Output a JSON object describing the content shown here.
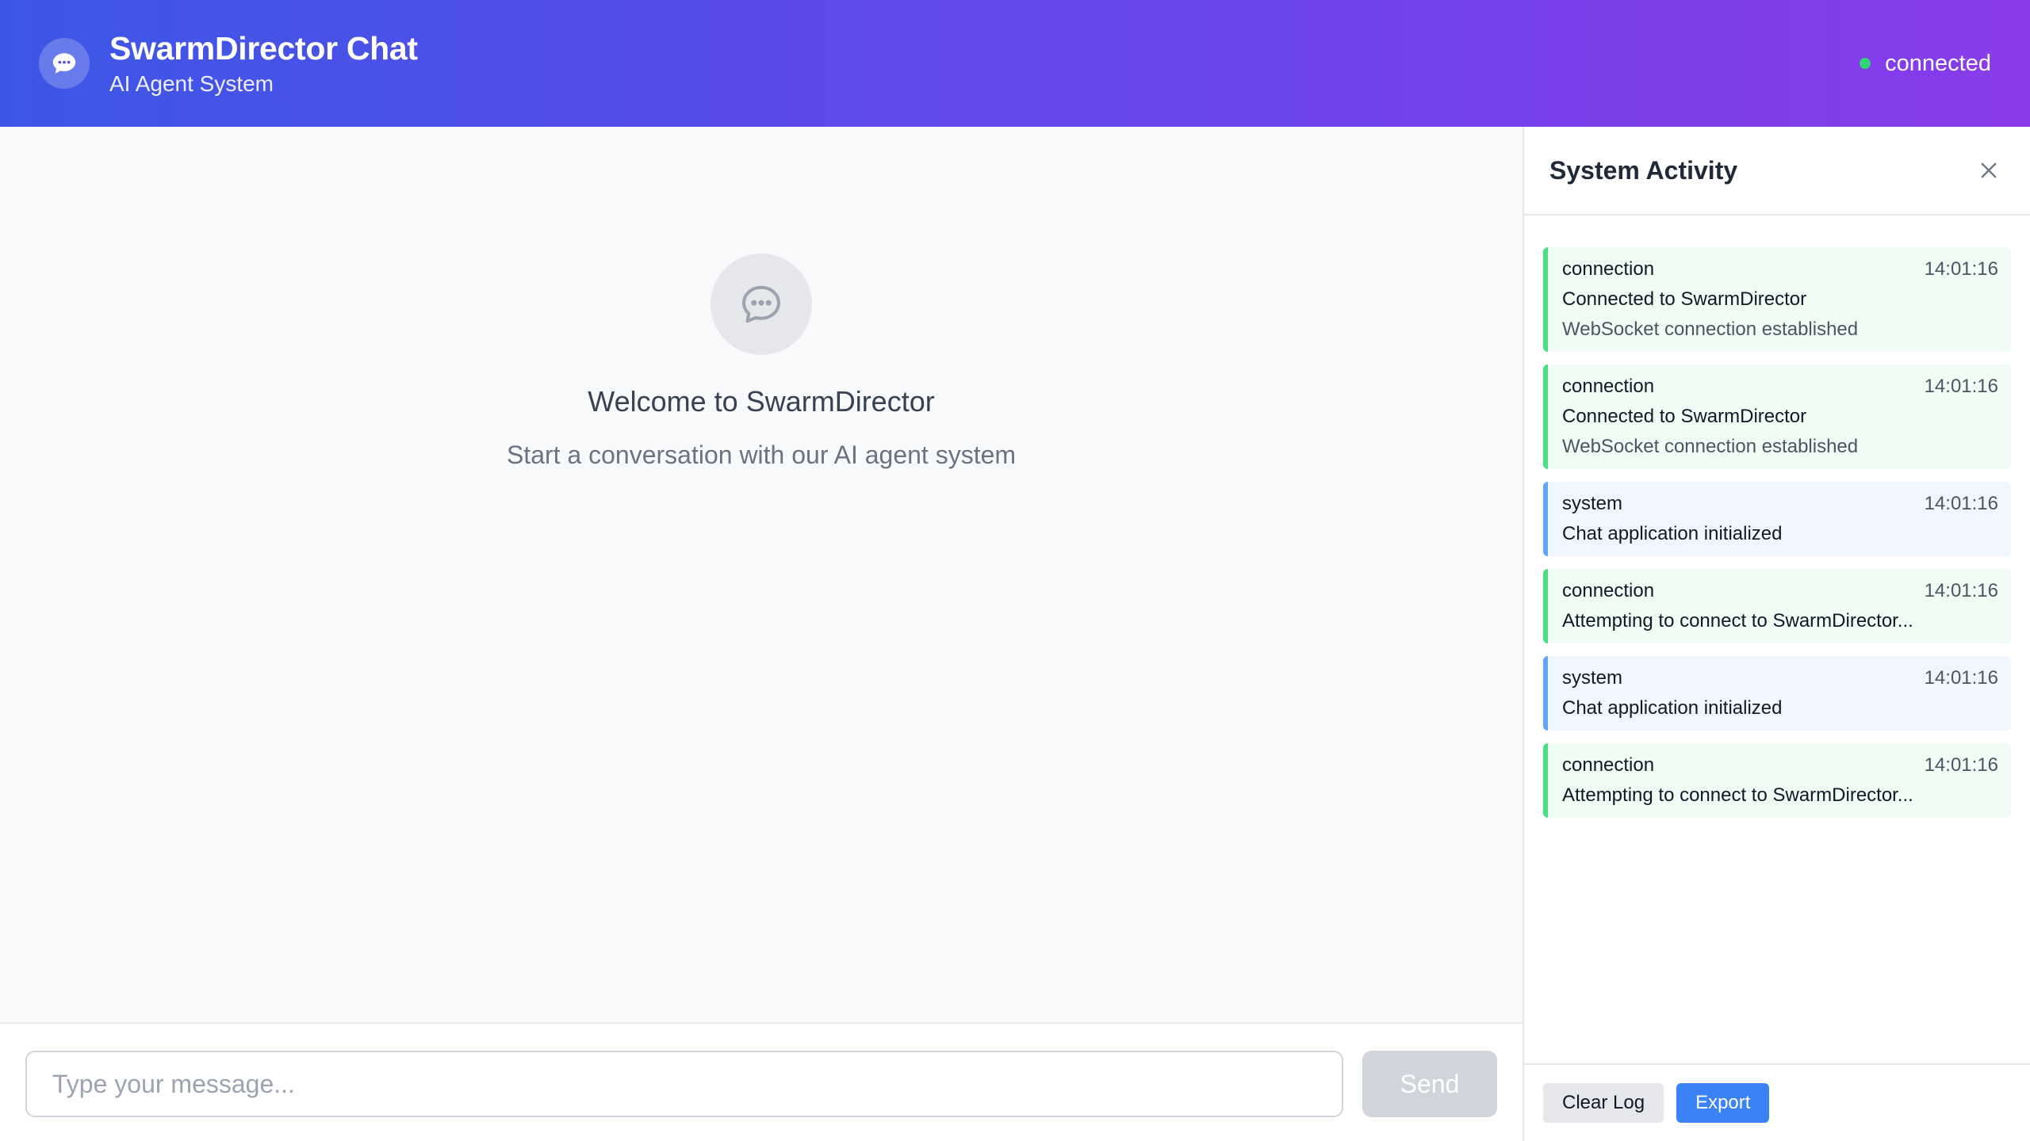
{
  "header": {
    "title": "SwarmDirector Chat",
    "subtitle": "AI Agent System",
    "status": "connected",
    "logo_icon": "chat-bubble-icon",
    "status_color": "#34d37a"
  },
  "welcome": {
    "icon": "chat-bubble-icon",
    "title": "Welcome to SwarmDirector",
    "text": "Start a conversation with our AI agent system"
  },
  "input": {
    "placeholder": "Type your message...",
    "send_label": "Send"
  },
  "sidebar": {
    "title": "System Activity",
    "close_icon": "close-icon",
    "logs": [
      {
        "type": "connection",
        "time": "14:01:16",
        "message": "Connected to SwarmDirector",
        "detail": "WebSocket connection established"
      },
      {
        "type": "connection",
        "time": "14:01:16",
        "message": "Connected to SwarmDirector",
        "detail": "WebSocket connection established"
      },
      {
        "type": "system",
        "time": "14:01:16",
        "message": "Chat application initialized",
        "detail": ""
      },
      {
        "type": "connection",
        "time": "14:01:16",
        "message": "Attempting to connect to SwarmDirector...",
        "detail": ""
      },
      {
        "type": "system",
        "time": "14:01:16",
        "message": "Chat application initialized",
        "detail": ""
      },
      {
        "type": "connection",
        "time": "14:01:16",
        "message": "Attempting to connect to SwarmDirector...",
        "detail": ""
      }
    ],
    "clear_label": "Clear Log",
    "export_label": "Export"
  },
  "colors": {
    "connection_accent": "#4ade80",
    "system_accent": "#60a5fa",
    "primary": "#3b82f6"
  }
}
